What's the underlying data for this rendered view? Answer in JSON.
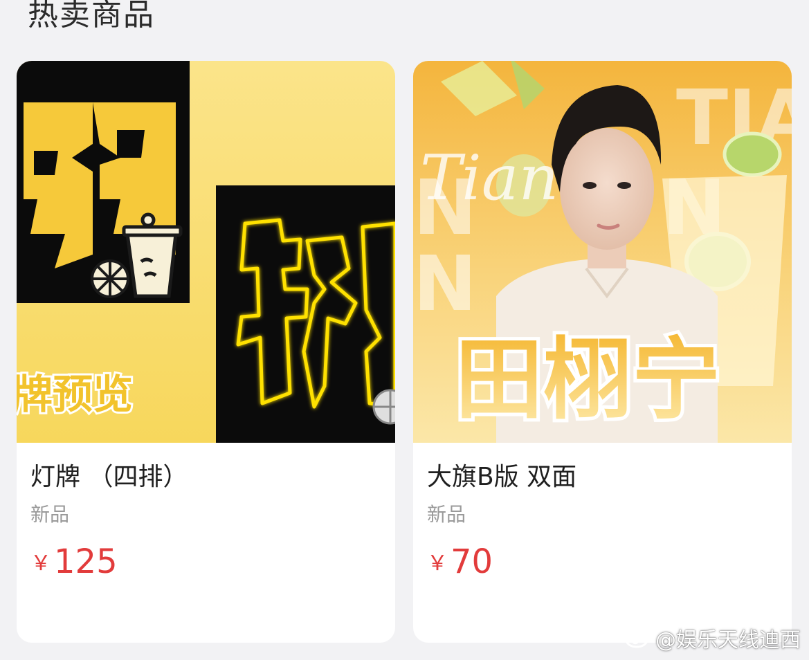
{
  "section": {
    "title": "热卖商品"
  },
  "products": [
    {
      "name": "灯牌 （四排）",
      "tag": "新品",
      "currency": "￥",
      "price": "125",
      "art_text": "牌预览"
    },
    {
      "name": "大旗B版 双面",
      "tag": "新品",
      "currency": "￥",
      "price": "70",
      "art_name": "田栩宁",
      "art_script": "Tian"
    }
  ],
  "watermark": {
    "text": "@娱乐天线迪西"
  },
  "colors": {
    "price_red": "#e23b3b",
    "card_bg": "#ffffff",
    "page_bg": "#f2f2f4",
    "accent_yellow": "#f6c93a"
  }
}
